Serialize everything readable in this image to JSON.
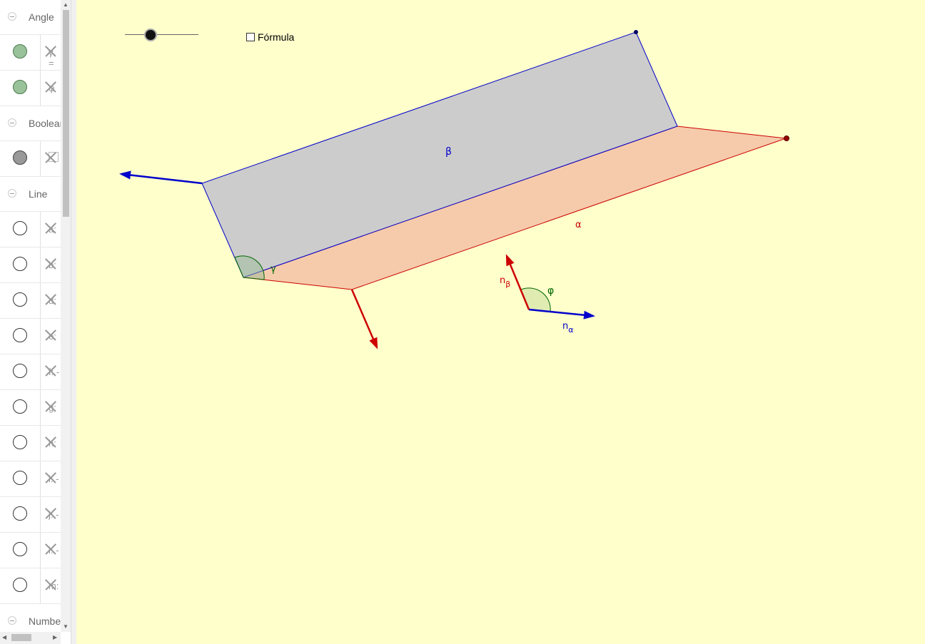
{
  "algebra": {
    "categories": [
      {
        "label": "Angle",
        "rows": [
          {
            "name": "γ =",
            "color": "green",
            "kind": "visible"
          },
          {
            "name": "φ",
            "color": "green",
            "kind": "visible"
          }
        ]
      },
      {
        "label": "Boolean",
        "rows": [
          {
            "name": "",
            "color": "gray",
            "kind": "checkbox"
          }
        ]
      },
      {
        "label": "Line",
        "rows": [
          {
            "name": "a:",
            "kind": "hidden"
          },
          {
            "name": "b:",
            "kind": "hidden"
          },
          {
            "name": "d:",
            "kind": "hidden"
          },
          {
            "name": "e:",
            "kind": "hidden"
          },
          {
            "name": "f: -",
            "kind": "hidden"
          },
          {
            "name": "g:",
            "kind": "hidden"
          },
          {
            "name": "h:",
            "kind": "hidden"
          },
          {
            "name": "i: -",
            "kind": "hidden"
          },
          {
            "name": "j: -",
            "kind": "hidden"
          },
          {
            "name": "l: -",
            "kind": "hidden"
          },
          {
            "name": "m:",
            "kind": "hidden"
          }
        ]
      },
      {
        "label": "Number",
        "rows": [
          {
            "name": "",
            "color": "gray",
            "kind": "visible"
          }
        ]
      }
    ]
  },
  "graphics": {
    "formula_label": "Fórmula",
    "formula_checked": false,
    "slider_value_fraction": 0.35,
    "labels": {
      "beta": "β",
      "alpha": "α",
      "gamma": "γ",
      "phi": "φ",
      "n_beta_base": "n",
      "n_beta_sub": "β",
      "n_alpha_base": "n",
      "n_alpha_sub": "α"
    },
    "colors": {
      "background": "#ffffcc",
      "plane_beta_fill": "#cccccc",
      "plane_alpha_fill": "#f5cbab",
      "blue": "#0000cc",
      "red": "#cc0000",
      "green": "#006600"
    }
  }
}
